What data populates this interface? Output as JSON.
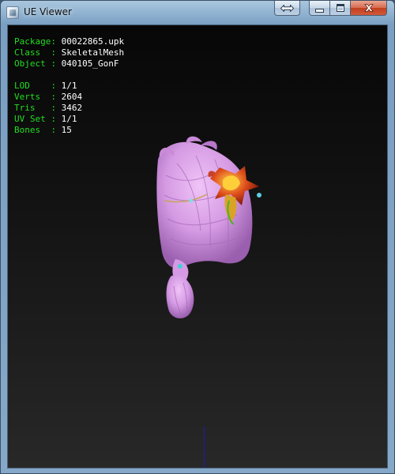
{
  "window": {
    "title": "UE Viewer"
  },
  "info": {
    "group1": [
      {
        "label": "Package: ",
        "value": "00022865.upk"
      },
      {
        "label": "Class  : ",
        "value": "SkeletalMesh"
      },
      {
        "label": "Object : ",
        "value": "040105_GonF"
      }
    ],
    "group2": [
      {
        "label": "LOD    : ",
        "value": "1/1"
      },
      {
        "label": "Verts  : ",
        "value": "2604"
      },
      {
        "label": "Tris   : ",
        "value": "3462"
      },
      {
        "label": "UV Set : ",
        "value": "1/1"
      },
      {
        "label": "Bones  : ",
        "value": "15"
      }
    ]
  },
  "icons": {
    "app": "ue-viewer-app-icon",
    "restore_size": "double-arrow-icon",
    "minimize": "minimize-icon",
    "maximize": "maximize-icon",
    "close": "close-icon"
  },
  "colors": {
    "label": "#22dd22",
    "value": "#ffffff",
    "viewport_top": "#070707",
    "viewport_bottom": "#282828",
    "hair": "#d59ae3",
    "accessory": "#e0501c",
    "axis": "#1a1ab8"
  }
}
